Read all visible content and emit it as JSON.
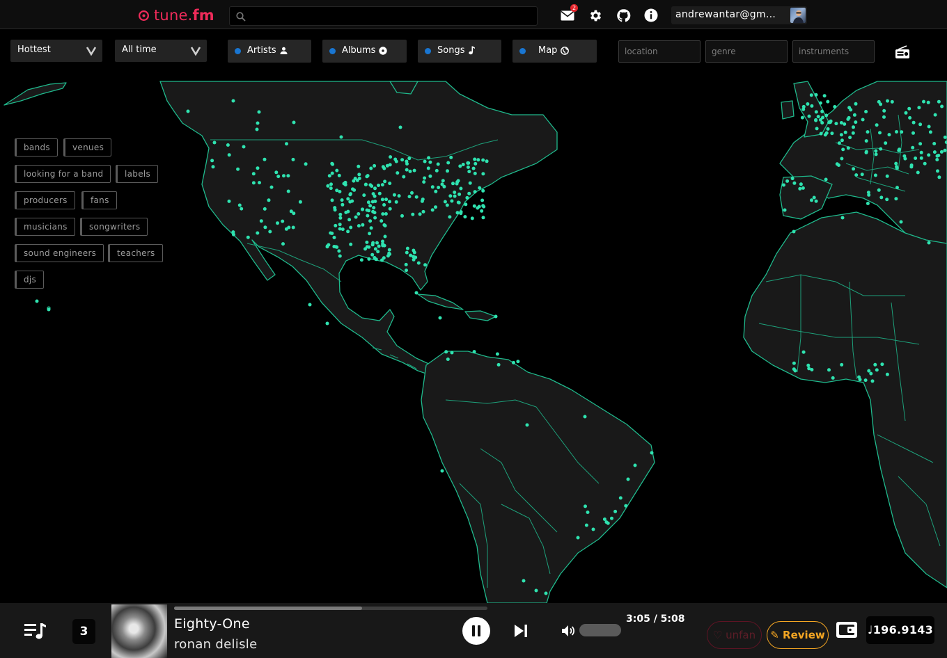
{
  "header": {
    "logo_text_light": "tune.",
    "logo_text_bold": "fm",
    "search_placeholder": "",
    "mail_badge": "2",
    "user_email": "andrewantar@gmail.com",
    "brand_color": "#ef2b5a"
  },
  "filters": {
    "sort": "Hottest",
    "period": "All time",
    "tabs": [
      {
        "label": "Artists",
        "icon": "person-icon"
      },
      {
        "label": "Albums",
        "icon": "disc-icon"
      },
      {
        "label": "Songs",
        "icon": "music-note-icon"
      },
      {
        "label": "Map",
        "icon": "globe-icon"
      }
    ],
    "location_placeholder": "location",
    "genre_placeholder": "genre",
    "instruments_placeholder": "instruments"
  },
  "tags": [
    "bands",
    "venues",
    "looking for a band",
    "labels",
    "producers",
    "fans",
    "musicians",
    "songwriters",
    "sound engineers",
    "teachers",
    "djs"
  ],
  "map": {
    "land_color": "#191919",
    "border_color": "#1fb98c",
    "marker_color": "#2fe3b0"
  },
  "player": {
    "queue_count": "3",
    "song_title": "Eighty-One",
    "artist": "ronan delisle",
    "time": "3:05 / 5:08",
    "progress": 0.6,
    "volume": 0.0,
    "unfan_label": "♡ unfan",
    "review_label": "✎ Review",
    "balance": "♩196.9143"
  }
}
